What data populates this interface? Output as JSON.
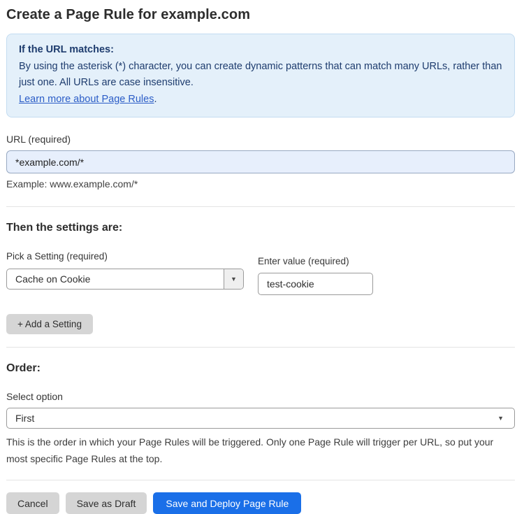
{
  "page": {
    "title": "Create a Page Rule for example.com"
  },
  "info_box": {
    "heading": "If the URL matches:",
    "body": "By using the asterisk (*) character, you can create dynamic patterns that can match many URLs, rather than just one. All URLs are case insensitive.",
    "link_label": "Learn more about Page Rules",
    "link_suffix": "."
  },
  "url_field": {
    "label": "URL (required)",
    "value": "*example.com/*",
    "helper": "Example: www.example.com/*"
  },
  "settings_section": {
    "heading": "Then the settings are:",
    "setting_label": "Pick a Setting (required)",
    "setting_selected": "Cache on Cookie",
    "value_label": "Enter value (required)",
    "value_text": "test-cookie",
    "add_button_label": "+ Add a Setting",
    "dropdown_arrow": "▼"
  },
  "order_section": {
    "heading": "Order:",
    "select_label": "Select option",
    "select_selected": "First",
    "dropdown_arrow": "▼",
    "helper": "This is the order in which your Page Rules will be triggered. Only one Page Rule will trigger per URL, so put your most specific Page Rules at the top."
  },
  "actions": {
    "cancel_label": "Cancel",
    "save_draft_label": "Save as Draft",
    "save_deploy_label": "Save and Deploy Page Rule"
  },
  "colors": {
    "primary_button_blue": "#1a6fe8",
    "info_box_bg": "#e4f0fa",
    "info_box_text": "#1e3c6e",
    "link_blue": "#2b5dc7",
    "url_input_bg": "#e7effc",
    "gray_button_bg": "#d5d5d5"
  }
}
